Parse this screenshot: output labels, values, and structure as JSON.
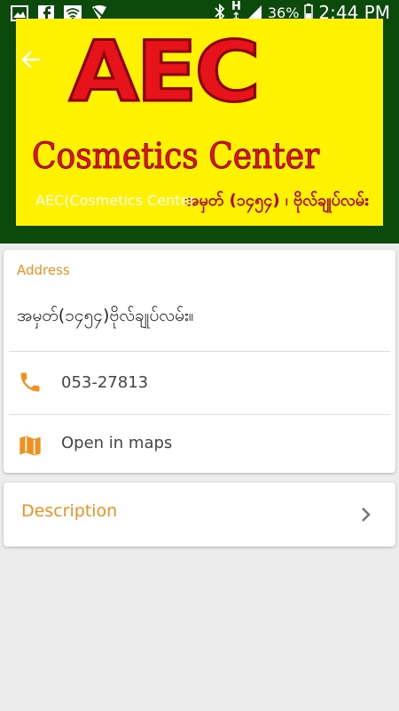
{
  "status_bar": {
    "battery": "36%",
    "time": "2:44 PM"
  },
  "header": {
    "title": "AEC(Cosmetics Center",
    "banner": {
      "brand": "AEC",
      "subtitle": "Cosmetics Center",
      "address_line": "အမှတ် (၁၄၅၄) ၊ ဗိုလ်ချုပ်လမ်း"
    }
  },
  "info_card": {
    "address_label": "Address",
    "address_value": "အမှတ်(၁၄၅၄)ဗိုလ်ချုပ်လမ်း။",
    "phone": "053-27813",
    "maps_label": "Open in maps"
  },
  "description_card": {
    "label": "Description"
  },
  "colors": {
    "header_bg": "#0b4a0b",
    "banner_bg": "#fff200",
    "accent": "#f0901f",
    "logo_red": "#e6131a"
  },
  "icons": [
    "image-icon",
    "facebook-icon",
    "wifi-icon",
    "no-sim-icon",
    "bluetooth-icon",
    "signal-icon",
    "battery-icon",
    "back-arrow-icon",
    "phone-icon",
    "map-icon",
    "chevron-right-icon"
  ]
}
